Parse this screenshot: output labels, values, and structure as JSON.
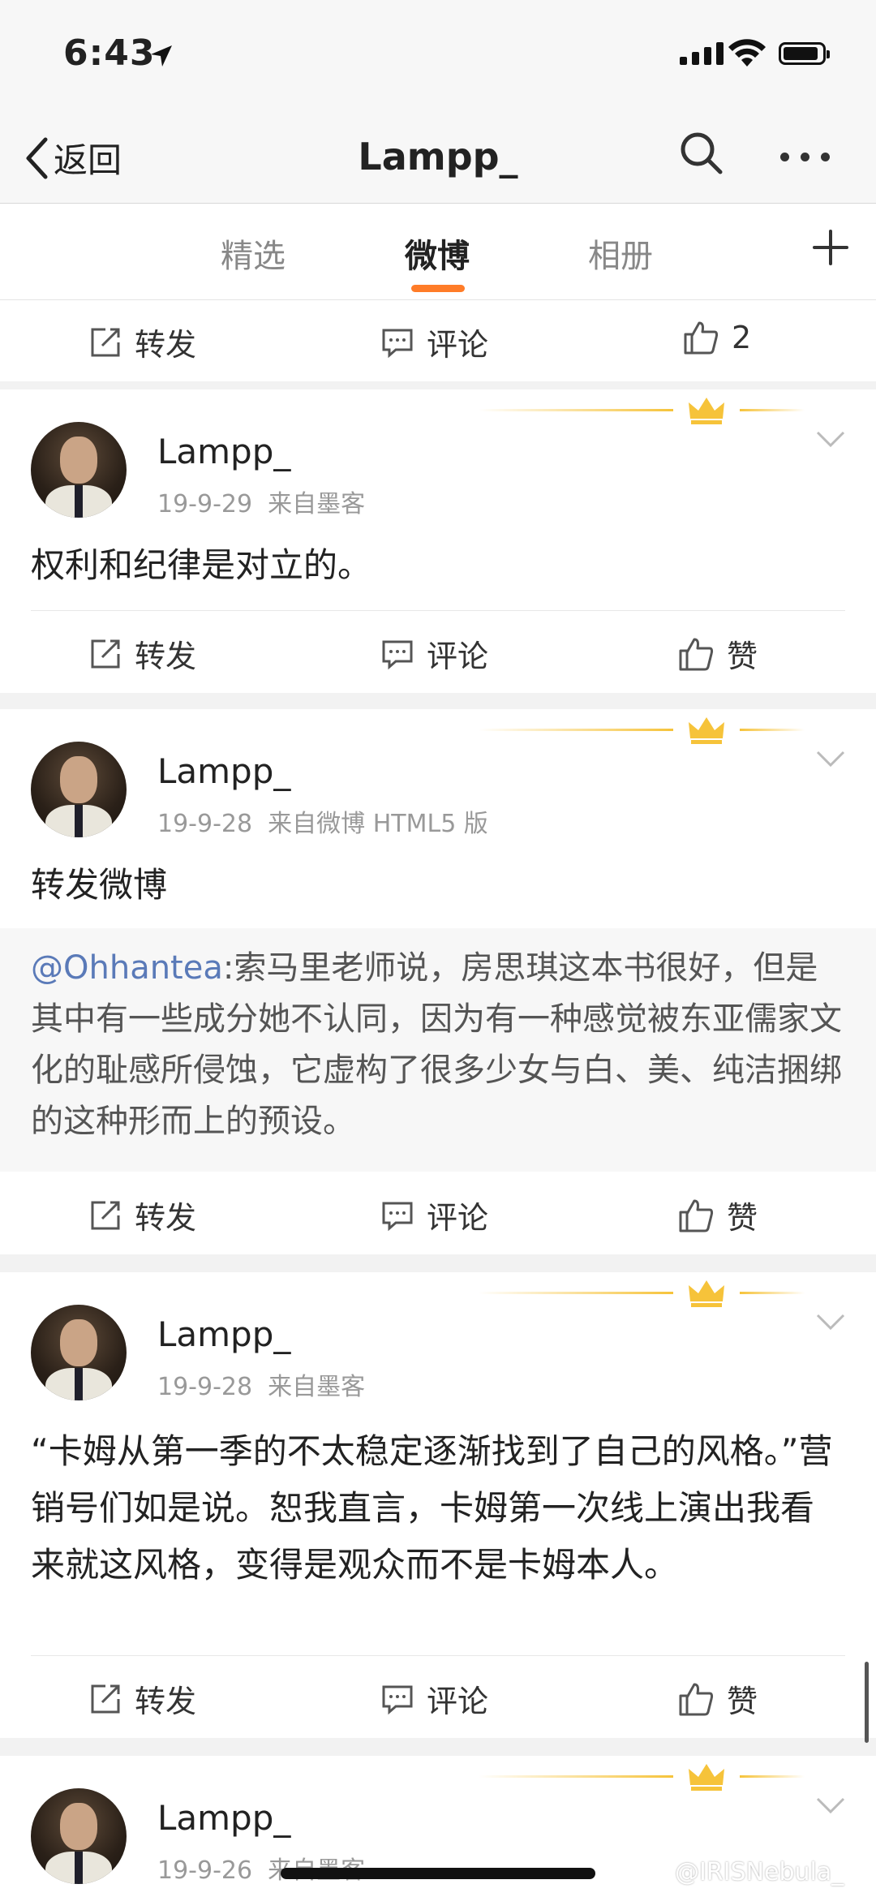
{
  "status_bar": {
    "time": "6:43"
  },
  "nav": {
    "back_label": "返回",
    "title": "Lampp_"
  },
  "tabs": [
    {
      "label": "精选"
    },
    {
      "label": "微博"
    },
    {
      "label": "相册"
    }
  ],
  "actions": {
    "repost": "转发",
    "comment": "评论",
    "like": "赞"
  },
  "top_row": {
    "like_count": "2"
  },
  "posts": [
    {
      "author": "Lampp_",
      "date": "19-9-29",
      "source": "来自墨客",
      "text": "权利和纪律是对立的。"
    },
    {
      "author": "Lampp_",
      "date": "19-9-28",
      "source": "来自微博 HTML5 版",
      "text": "转发微博",
      "repost": {
        "mention": "@Ohhantea",
        "text": ":索马里老师说，房思琪这本书很好，但是其中有一些成分她不认同，因为有一种感觉被东亚儒家文化的耻感所侵蚀，它虚构了很多少女与白、美、纯洁捆绑的这种形而上的预设。"
      }
    },
    {
      "author": "Lampp_",
      "date": "19-9-28",
      "source": "来自墨客",
      "text": "“卡姆从第一季的不太稳定逐渐找到了自己的风格。”营销号们如是说。恕我直言，卡姆第一次线上演出我看来就这风格，变得是观众而不是卡姆本人。"
    },
    {
      "author": "Lampp_",
      "date": "19-9-26",
      "source": "来自墨客"
    }
  ],
  "watermark": "@IRISNebula_",
  "colors": {
    "accent": "#ff7c28",
    "mention": "#5a7ab8",
    "crown": "#f6c33a"
  }
}
